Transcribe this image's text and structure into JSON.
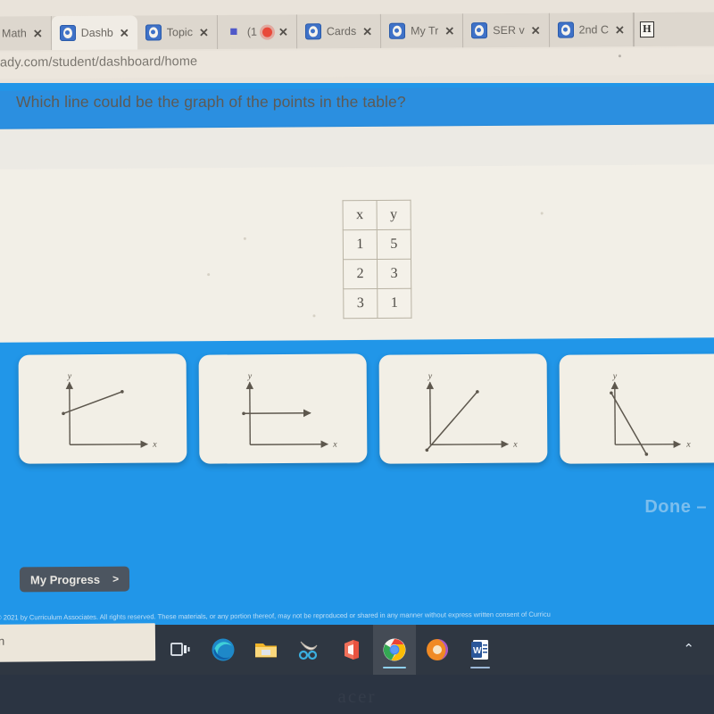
{
  "browser": {
    "tabs": [
      {
        "title": "Math",
        "has_favicon": false,
        "close": "✕"
      },
      {
        "title": "Dashb",
        "has_favicon": true,
        "close": "✕"
      },
      {
        "title": "Topic",
        "has_favicon": true,
        "close": "✕"
      },
      {
        "title": "(1",
        "has_favicon": true,
        "icon": "teams-icon",
        "recording": true,
        "close": "✕"
      },
      {
        "title": "Cards",
        "has_favicon": true,
        "close": "✕"
      },
      {
        "title": "My Tr",
        "has_favicon": true,
        "close": "✕"
      },
      {
        "title": "SER v",
        "has_favicon": true,
        "close": "✕"
      },
      {
        "title": "2nd C",
        "has_favicon": true,
        "close": "✕"
      }
    ],
    "extra_tab_glyph": "H",
    "url": "ady.com/student/dashboard/home"
  },
  "app": {
    "question": "Which line could be the graph of the points in the table?",
    "table": {
      "headers": [
        "x",
        "y"
      ],
      "rows": [
        [
          "1",
          "5"
        ],
        [
          "2",
          "3"
        ],
        [
          "3",
          "1"
        ]
      ]
    },
    "choices": [
      {
        "id": "choice-a",
        "axis_x_label": "x",
        "axis_y_label": "y",
        "line": "increasing-shallow"
      },
      {
        "id": "choice-b",
        "axis_x_label": "x",
        "axis_y_label": "y",
        "line": "horizontal"
      },
      {
        "id": "choice-c",
        "axis_x_label": "x",
        "axis_y_label": "y",
        "line": "increasing-steep"
      },
      {
        "id": "choice-d",
        "axis_x_label": "x",
        "axis_y_label": "y",
        "line": "decreasing-steep"
      }
    ],
    "done_label": "Done  –",
    "progress_label": "My Progress",
    "progress_chevron": ">",
    "copyright": "© 2021 by Curriculum Associates. All rights reserved. These materials, or any portion thereof, may not be reproduced or shared in any manner without express written consent of Curricu"
  },
  "taskbar": {
    "search_text": "h",
    "items": [
      {
        "name": "task-view-icon",
        "label": "Task View"
      },
      {
        "name": "edge-icon",
        "label": "Microsoft Edge"
      },
      {
        "name": "file-explorer-icon",
        "label": "File Explorer"
      },
      {
        "name": "snip-sketch-icon",
        "label": "Snip & Sketch"
      },
      {
        "name": "office-icon",
        "label": "Office"
      },
      {
        "name": "chrome-icon",
        "label": "Google Chrome"
      },
      {
        "name": "firefox-icon",
        "label": "Browser"
      },
      {
        "name": "word-icon",
        "label": "Word"
      }
    ],
    "tray_chevron": "⌃"
  },
  "monitor": {
    "brand": "acer"
  },
  "colors": {
    "app_blue": "#2196e8",
    "header_blue": "#2b8fe0",
    "panel_cream": "#f2efe7",
    "taskbar": "#2f3742",
    "record_red": "#e8493a"
  }
}
